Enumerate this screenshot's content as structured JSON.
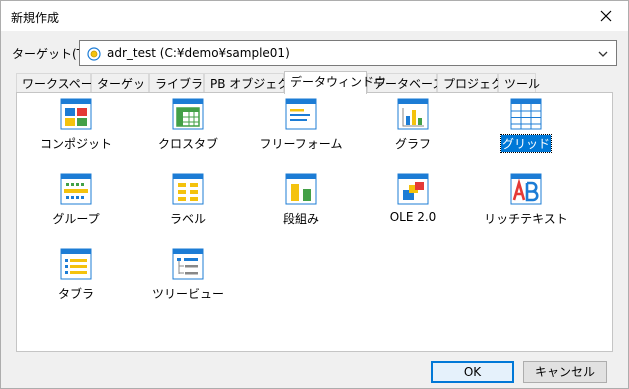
{
  "window": {
    "title": "新規作成"
  },
  "target": {
    "label": "ターゲット(T):",
    "value": "adr_test (C:¥demo¥sample01)"
  },
  "tabs": [
    {
      "label": "ワークスペース"
    },
    {
      "label": "ターゲット"
    },
    {
      "label": "ライブラリ"
    },
    {
      "label": "PB オブジェクト"
    },
    {
      "label": "データウィンドウ"
    },
    {
      "label": "データベース"
    },
    {
      "label": "プロジェクト"
    },
    {
      "label": "ツール"
    }
  ],
  "active_tab": "データウィンドウ",
  "items": [
    {
      "label": "コンポジット",
      "icon": "composite-icon"
    },
    {
      "label": "クロスタブ",
      "icon": "crosstab-icon"
    },
    {
      "label": "フリーフォーム",
      "icon": "freeform-icon"
    },
    {
      "label": "グラフ",
      "icon": "graph-icon"
    },
    {
      "label": "グリッド",
      "icon": "grid-icon",
      "selected": true
    },
    {
      "label": "グループ",
      "icon": "group-icon"
    },
    {
      "label": "ラベル",
      "icon": "label-icon"
    },
    {
      "label": "段組み",
      "icon": "ncolumn-icon"
    },
    {
      "label": "OLE 2.0",
      "icon": "ole-icon"
    },
    {
      "label": "リッチテキスト",
      "icon": "richtext-icon"
    },
    {
      "label": "タブラ",
      "icon": "tabular-icon"
    },
    {
      "label": "ツリービュー",
      "icon": "treeview-icon"
    }
  ],
  "buttons": {
    "ok": "OK",
    "cancel": "キャンセル"
  },
  "colors": {
    "accent": "#0078d7",
    "icon_blue": "#1c7cd5",
    "icon_red": "#e53935",
    "icon_yellow": "#f4c20d",
    "icon_green": "#43a047"
  }
}
